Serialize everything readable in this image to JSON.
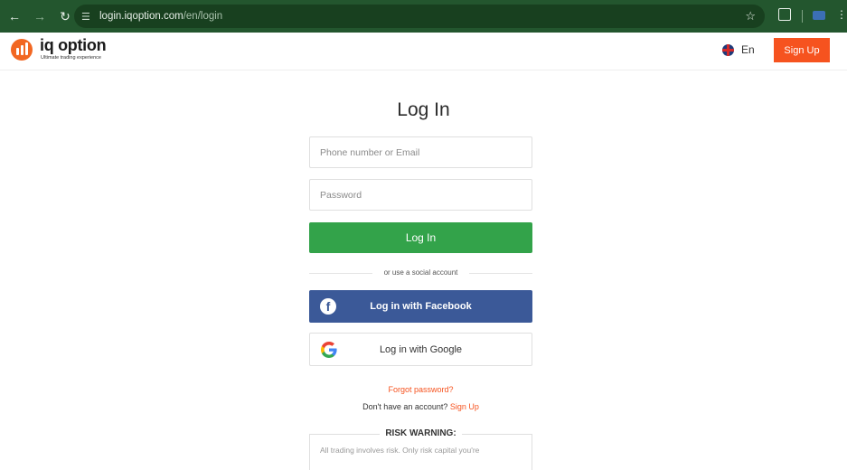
{
  "browser": {
    "url_host": "login.iqoption.com",
    "url_path": "/en/login",
    "icons": [
      "back-arrow-icon",
      "forward-arrow-icon",
      "reload-icon",
      "site-settings-icon",
      "bookmark-star-icon",
      "extensions-icon",
      "profile-icon",
      "menu-icon"
    ]
  },
  "header": {
    "logo_name": "iq option",
    "logo_tagline": "Ultimate trading experience",
    "language": "En",
    "signup_label": "Sign Up",
    "accent_color": "#f6531f"
  },
  "login": {
    "title": "Log In",
    "identifier_placeholder": "Phone number or Email",
    "password_placeholder": "Password",
    "submit_label": "Log In",
    "submit_color": "#33a34a",
    "separator_text": "or use a social account",
    "facebook_label": "Log in with Facebook",
    "facebook_color": "#3b5998",
    "google_label": "Log in with Google",
    "forgot_label": "Forgot password?",
    "no_account_text": "Don't have an account?",
    "signup_link": "Sign Up"
  },
  "risk": {
    "title": "RISK WARNING:",
    "text": "All trading involves risk. Only risk capital you're"
  }
}
